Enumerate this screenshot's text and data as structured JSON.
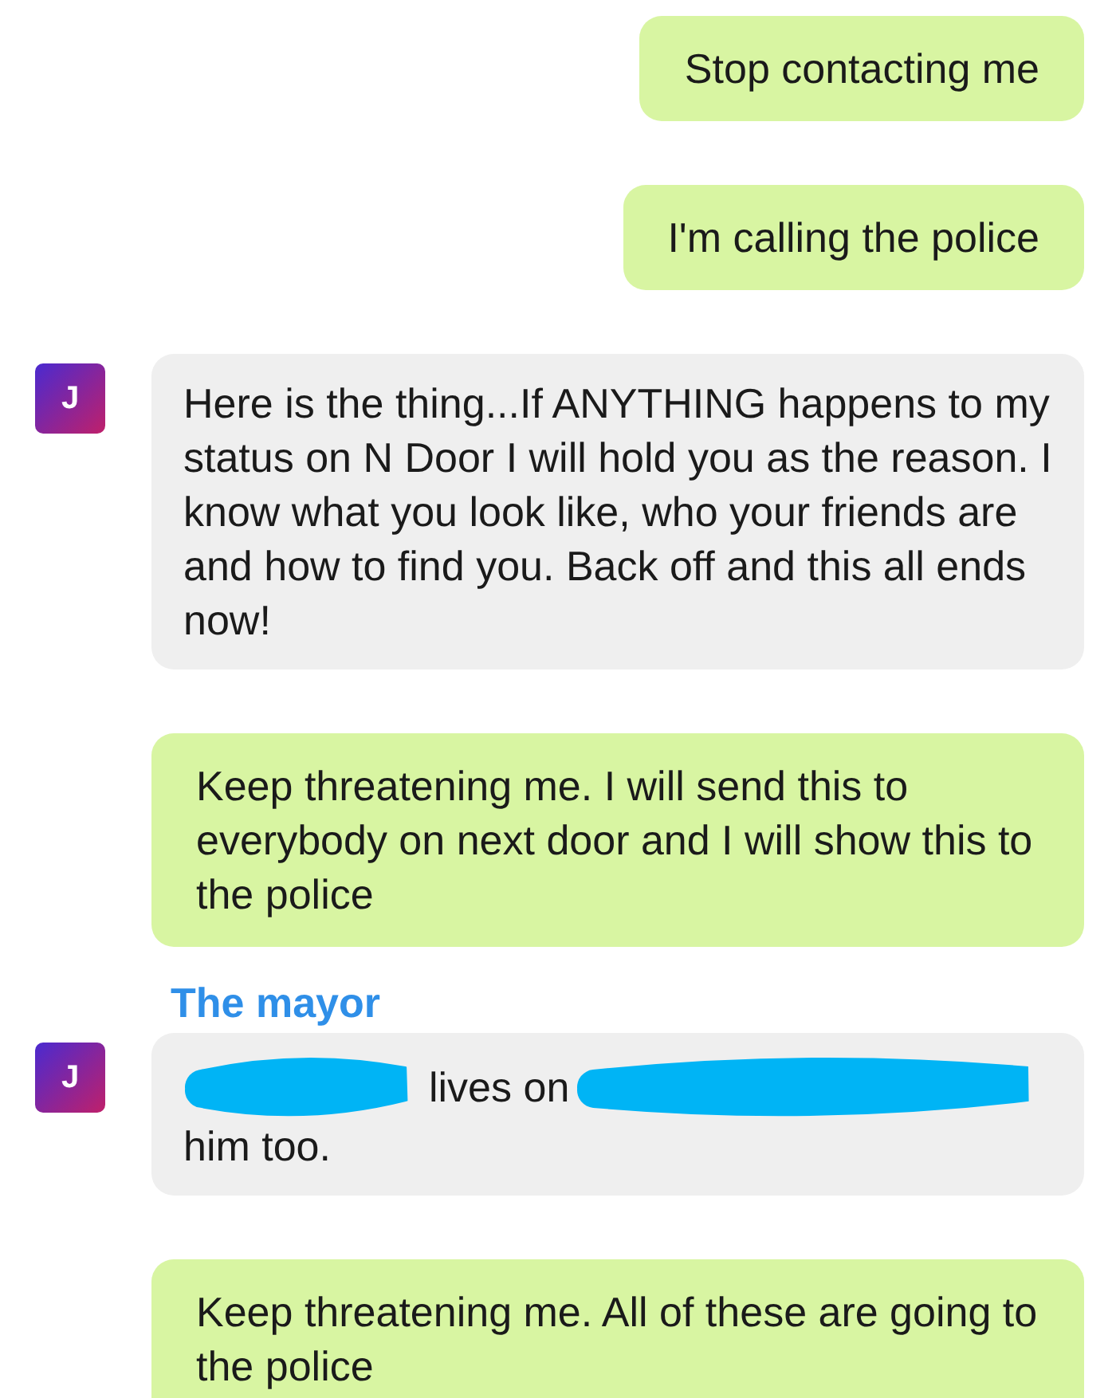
{
  "messages": [
    {
      "kind": "sent",
      "text": "Stop contacting me"
    },
    {
      "kind": "sent",
      "text": "I'm calling the police"
    },
    {
      "kind": "received",
      "avatar": "J",
      "text": "Here is the thing...If ANYTHING happens to my status on N Door I will hold you as the reason. I know what you look like, who your friends are and how to find you. Back off and this all ends now!"
    },
    {
      "kind": "sent",
      "text": "Keep threatening me. I will send this to everybody on next door and I will show this to the police"
    },
    {
      "kind": "label",
      "text": "The mayor"
    },
    {
      "kind": "redacted",
      "avatar": "J",
      "line_1": "lives on",
      "line_2": "him too."
    },
    {
      "kind": "sent",
      "text": "Keep threatening me. All of these are going to the police"
    }
  ]
}
